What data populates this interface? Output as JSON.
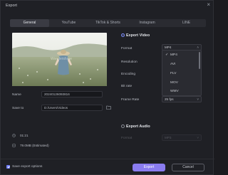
{
  "window": {
    "title": "Export",
    "close_glyph": "×"
  },
  "tabs": [
    "General",
    "YouTube",
    "TikTok & Shorts",
    "Instagram",
    "LINE"
  ],
  "left": {
    "name_label": "Name",
    "name_value": "20240126093816",
    "save_label": "Save to",
    "save_value": "D:/Users/Videos",
    "duration": "01:21",
    "size": "79.0MB (Estimated)"
  },
  "export_video": {
    "heading": "Export Video",
    "format_label": "Format",
    "format_value": "MP4",
    "resolution_label": "Resolution",
    "encoding_label": "Encoding",
    "bitrate_label": "Bit rate",
    "framerate_label": "Frame Rate",
    "framerate_value": "25  fps",
    "dropdown_options": [
      "MP4",
      "AVI",
      "FLV",
      "MOV",
      "WMV"
    ],
    "selected_option": "MP4"
  },
  "export_audio": {
    "heading": "Export Audio",
    "format_label": "Format",
    "format_value": "MP3"
  },
  "footer": {
    "save_options_label": "Save export options",
    "export_button": "Export",
    "cancel_button": "Cancel"
  },
  "colors": {
    "accent": "#8a7cf0",
    "background": "#1f2025"
  }
}
